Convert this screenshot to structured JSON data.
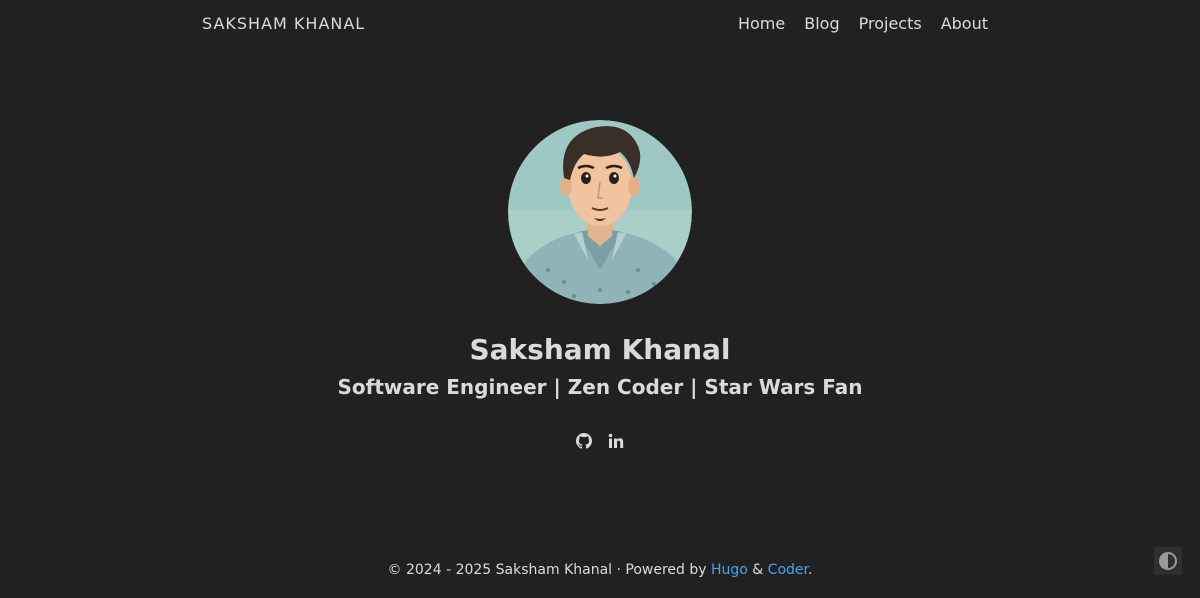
{
  "nav": {
    "brand": "SAKSHAM KHANAL",
    "items": [
      {
        "label": "Home"
      },
      {
        "label": "Blog"
      },
      {
        "label": "Projects"
      },
      {
        "label": "About"
      }
    ]
  },
  "profile": {
    "avatar_icon": "avatar-illustration",
    "name": "Saksham Khanal",
    "tagline": "Software Engineer | Zen Coder | Star Wars Fan"
  },
  "social": [
    {
      "icon": "github-icon"
    },
    {
      "icon": "linkedin-icon"
    }
  ],
  "footer": {
    "copyright": "© 2024 - 2025 Saksham Khanal · Powered by ",
    "hugo": "Hugo",
    "amp": " & ",
    "coder": "Coder",
    "end": "."
  },
  "colors": {
    "background": "#212121",
    "text": "#dadada",
    "link": "#42a5f5"
  },
  "theme_toggle_icon": "contrast-icon"
}
